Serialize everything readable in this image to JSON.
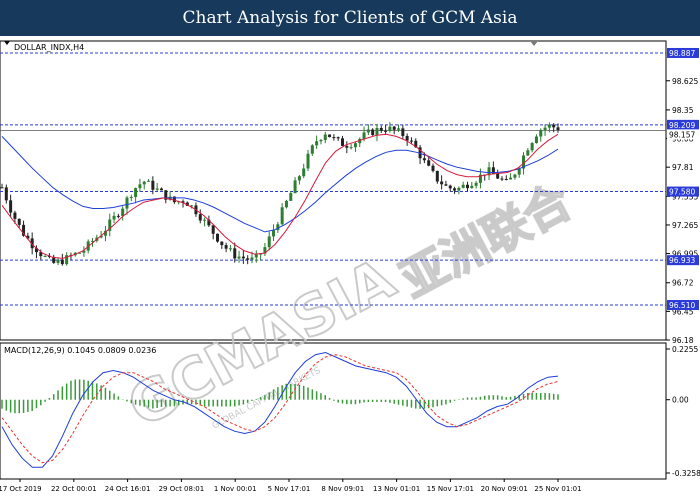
{
  "header": {
    "title": "Chart Analysis for Clients of GCM Asia"
  },
  "colors": {
    "title_bar": "#173a5c",
    "up_candle": "#2e7d32",
    "down_candle": "#222222",
    "ma_fast": "#d81b3c",
    "ma_slow": "#1e3fd8",
    "level_line": "#2a3bd8",
    "macd_line": "#1e3fd8",
    "signal_line": "#e53935",
    "histogram": "#3a9a3a",
    "watermark": "#c7c7c7"
  },
  "watermark": {
    "main": "GCMASIA",
    "sub": "GLOBAL CAPITAL MARKETS",
    "cn": "亚洲联合"
  },
  "chart_data": [
    {
      "type": "candlestick",
      "symbol_label": "DOLLAR_INDX,H4",
      "ylim": [
        96.18,
        99.0
      ],
      "y_ticks": [
        98.625,
        98.35,
        98.08,
        97.81,
        97.535,
        97.265,
        96.995,
        96.72,
        96.45,
        96.18
      ],
      "levels": [
        98.887,
        98.209,
        97.58,
        96.933,
        96.51
      ],
      "current_price": "98.157",
      "x_labels": [
        "17 Oct 2019",
        "22 Oct 00:01",
        "24 Oct 16:01",
        "29 Oct 08:01",
        "1 Nov 00:01",
        "5 Nov 17:01",
        "8 Nov 09:01",
        "13 Nov 01:01",
        "15 Nov 17:01",
        "20 Nov 09:01",
        "25 Nov 01:01"
      ],
      "price_path": [
        97.62,
        97.38,
        97.2,
        97.08,
        96.98,
        96.9,
        96.93,
        96.98,
        97.02,
        97.12,
        97.2,
        97.32,
        97.45,
        97.6,
        97.68,
        97.62,
        97.55,
        97.48,
        97.5,
        97.42,
        97.3,
        97.18,
        97.06,
        96.98,
        96.95,
        96.93,
        97.05,
        97.25,
        97.45,
        97.65,
        97.85,
        98.05,
        98.14,
        98.06,
        98.02,
        98.05,
        98.12,
        98.16,
        98.18,
        98.15,
        98.1,
        97.98,
        97.82,
        97.7,
        97.62,
        97.6,
        97.65,
        97.7,
        97.78,
        97.72,
        97.65,
        97.8,
        98.0,
        98.15,
        98.2,
        98.18
      ],
      "ma_fast_path": [
        97.45,
        97.32,
        97.2,
        97.08,
        97.0,
        96.96,
        96.95,
        96.98,
        97.02,
        97.1,
        97.18,
        97.26,
        97.35,
        97.42,
        97.48,
        97.5,
        97.52,
        97.5,
        97.47,
        97.42,
        97.35,
        97.26,
        97.16,
        97.08,
        97.02,
        96.99,
        97.0,
        97.08,
        97.2,
        97.34,
        97.5,
        97.68,
        97.85,
        97.96,
        98.02,
        98.05,
        98.08,
        98.11,
        98.12,
        98.1,
        98.06,
        98.0,
        97.92,
        97.84,
        97.78,
        97.74,
        97.72,
        97.72,
        97.74,
        97.75,
        97.76,
        97.8,
        97.88,
        97.98,
        98.06,
        98.12
      ],
      "ma_slow_path": [
        98.1,
        98.0,
        97.9,
        97.8,
        97.71,
        97.62,
        97.55,
        97.49,
        97.44,
        97.42,
        97.42,
        97.43,
        97.45,
        97.47,
        97.5,
        97.51,
        97.52,
        97.52,
        97.52,
        97.5,
        97.47,
        97.43,
        97.38,
        97.33,
        97.28,
        97.24,
        97.2,
        97.22,
        97.27,
        97.33,
        97.4,
        97.48,
        97.57,
        97.65,
        97.73,
        97.8,
        97.86,
        97.91,
        97.95,
        97.97,
        97.97,
        97.95,
        97.92,
        97.88,
        97.84,
        97.81,
        97.79,
        97.77,
        97.76,
        97.76,
        97.77,
        97.79,
        97.83,
        97.87,
        97.92,
        97.98
      ]
    },
    {
      "type": "macd",
      "label": "MACD(12,26,9) 0.1045 0.0809 0.0236",
      "ylim": [
        -0.3258,
        0.2255
      ],
      "y_ticks": [
        "0.2255",
        "0.00",
        "-0.3258"
      ],
      "macd_path": [
        -0.12,
        -0.2,
        -0.26,
        -0.3,
        -0.3,
        -0.25,
        -0.16,
        -0.06,
        0.02,
        0.08,
        0.12,
        0.13,
        0.12,
        0.1,
        0.07,
        0.04,
        0.02,
        0.0,
        -0.01,
        -0.03,
        -0.06,
        -0.09,
        -0.12,
        -0.14,
        -0.15,
        -0.14,
        -0.1,
        -0.03,
        0.05,
        0.12,
        0.17,
        0.2,
        0.21,
        0.19,
        0.17,
        0.15,
        0.14,
        0.13,
        0.12,
        0.1,
        0.06,
        0.0,
        -0.06,
        -0.1,
        -0.12,
        -0.12,
        -0.1,
        -0.08,
        -0.05,
        -0.03,
        -0.02,
        0.01,
        0.05,
        0.08,
        0.1,
        0.105
      ],
      "signal_path": [
        -0.08,
        -0.14,
        -0.2,
        -0.25,
        -0.28,
        -0.27,
        -0.22,
        -0.15,
        -0.07,
        0.0,
        0.06,
        0.1,
        0.12,
        0.12,
        0.1,
        0.08,
        0.05,
        0.03,
        0.01,
        -0.01,
        -0.03,
        -0.06,
        -0.09,
        -0.11,
        -0.13,
        -0.14,
        -0.12,
        -0.08,
        -0.02,
        0.05,
        0.11,
        0.16,
        0.19,
        0.2,
        0.19,
        0.17,
        0.15,
        0.14,
        0.13,
        0.12,
        0.09,
        0.04,
        -0.02,
        -0.07,
        -0.1,
        -0.12,
        -0.11,
        -0.09,
        -0.07,
        -0.05,
        -0.03,
        -0.01,
        0.02,
        0.05,
        0.07,
        0.081
      ]
    }
  ]
}
